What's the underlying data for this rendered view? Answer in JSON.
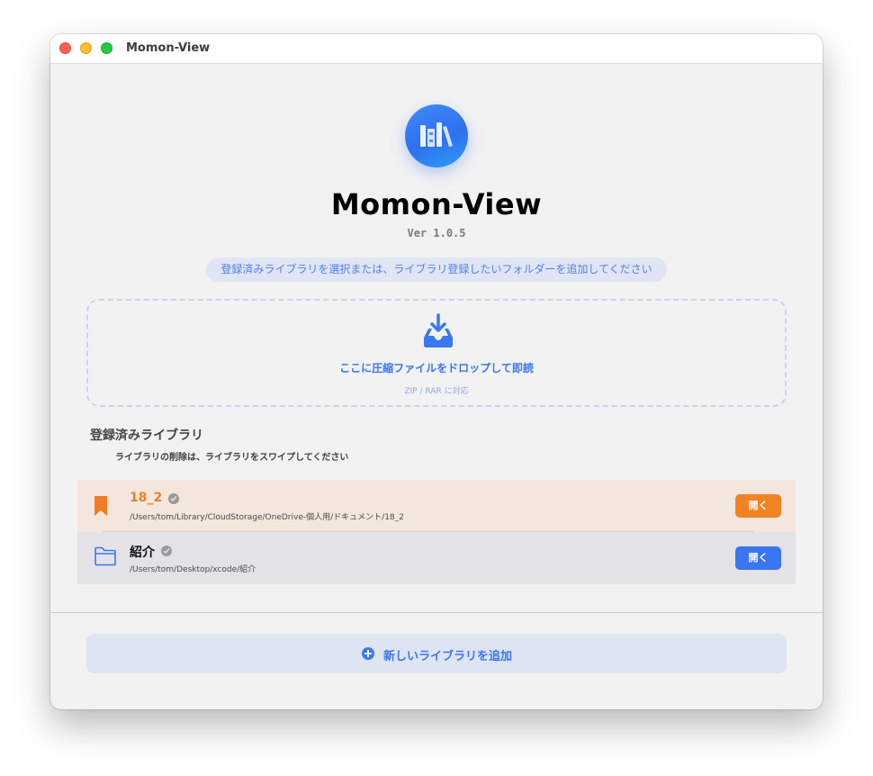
{
  "window": {
    "title": "Momon-View"
  },
  "app": {
    "name": "Momon-View",
    "version": "Ver 1.0.5"
  },
  "hint": "登録済みライブラリを選択または、ライブラリ登録したいフォルダーを追加してください",
  "dropzone": {
    "title": "ここに圧縮ファイルをドロップして即読",
    "subtitle": "ZIP / RAR に対応"
  },
  "library": {
    "heading": "登録済みライブラリ",
    "subheading": "ライブラリの削除は、ライブラリをスワイプしてください",
    "items": [
      {
        "name": "18_2",
        "path": "/Users/tom/Library/CloudStorage/OneDrive-個人用/ドキュメント/18_2",
        "open_label": "開く",
        "icon": "bookmark-icon",
        "accent": "#f28323"
      },
      {
        "name": "紹介",
        "path": "/Users/tom/Desktop/xcode/紹介",
        "open_label": "開く",
        "icon": "folder-icon",
        "accent": "#3b75f4"
      }
    ]
  },
  "add_button": {
    "label": "新しいライブラリを追加"
  }
}
